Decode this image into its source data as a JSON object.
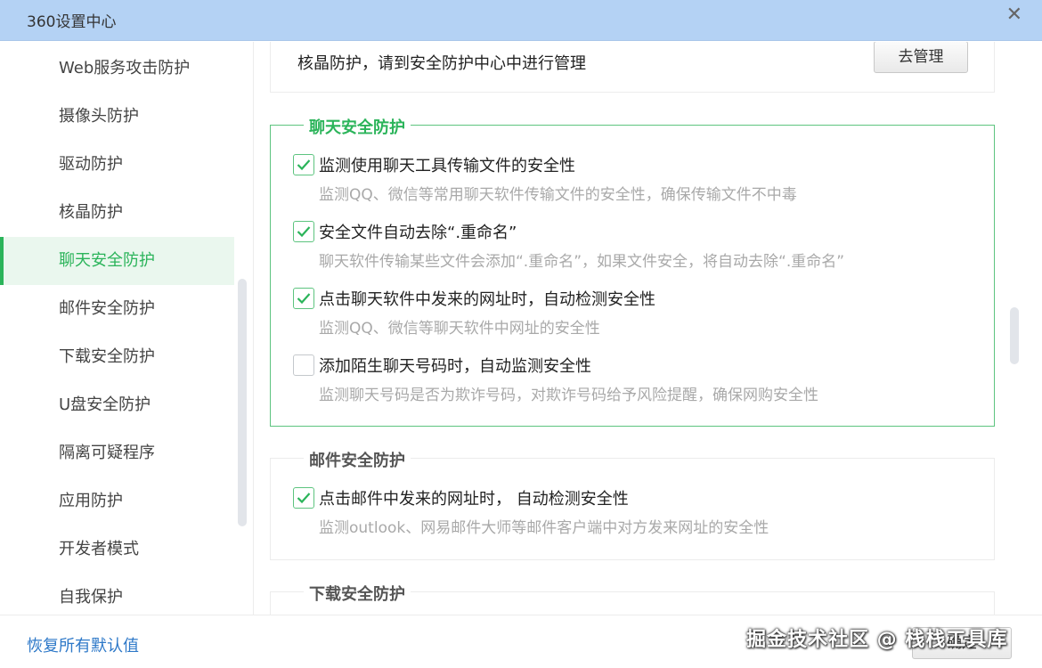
{
  "window": {
    "title": "360设置中心",
    "close_glyph": "✕"
  },
  "sidebar": {
    "items": [
      {
        "label": "Web服务攻击防护"
      },
      {
        "label": "摄像头防护"
      },
      {
        "label": "驱动防护"
      },
      {
        "label": "核晶防护"
      },
      {
        "label": "聊天安全防护",
        "active": true
      },
      {
        "label": "邮件安全防护"
      },
      {
        "label": "下载安全防护"
      },
      {
        "label": "U盘安全防护"
      },
      {
        "label": "隔离可疑程序"
      },
      {
        "label": "应用防护"
      },
      {
        "label": "开发者模式"
      },
      {
        "label": "自我保护"
      }
    ]
  },
  "content": {
    "kernel": {
      "text": "核晶防护，请到安全防护中心中进行管理",
      "button": "去管理"
    },
    "chat": {
      "title": "聊天安全防护",
      "options": [
        {
          "label": "监测使用聊天工具传输文件的安全性",
          "desc": "监测QQ、微信等常用聊天软件传输文件的安全性，确保传输文件不中毒",
          "checked": true
        },
        {
          "label": "安全文件自动去除“.重命名”",
          "desc": "聊天软件传输某些文件会添加“.重命名”，如果文件安全，将自动去除“.重命名”",
          "checked": true
        },
        {
          "label": "点击聊天软件中发来的网址时，自动检测安全性",
          "desc": "监测QQ、微信等聊天软件中网址的安全性",
          "checked": true
        },
        {
          "label": "添加陌生聊天号码时，自动监测安全性",
          "desc": "监测聊天号码是否为欺诈号码，对欺诈号码给予风险提醒，确保网购安全性",
          "checked": false
        }
      ]
    },
    "mail": {
      "title": "邮件安全防护",
      "options": [
        {
          "label": "点击邮件中发来的网址时， 自动检测安全性",
          "desc": "监测outlook、网易邮件大师等邮件客户端中对方发来网址的安全性",
          "checked": true
        }
      ]
    },
    "download": {
      "title": "下载安全防护"
    }
  },
  "footer": {
    "reset": "恢复所有默认值",
    "ok": "确定"
  },
  "watermark": "掘金技术社区 @ 栈栈工具库",
  "colors": {
    "accent": "#2bb45a",
    "titlebar": "#b4d2f4",
    "link": "#2d78c8"
  },
  "icons": {
    "check": "check-icon",
    "close": "close-icon"
  }
}
